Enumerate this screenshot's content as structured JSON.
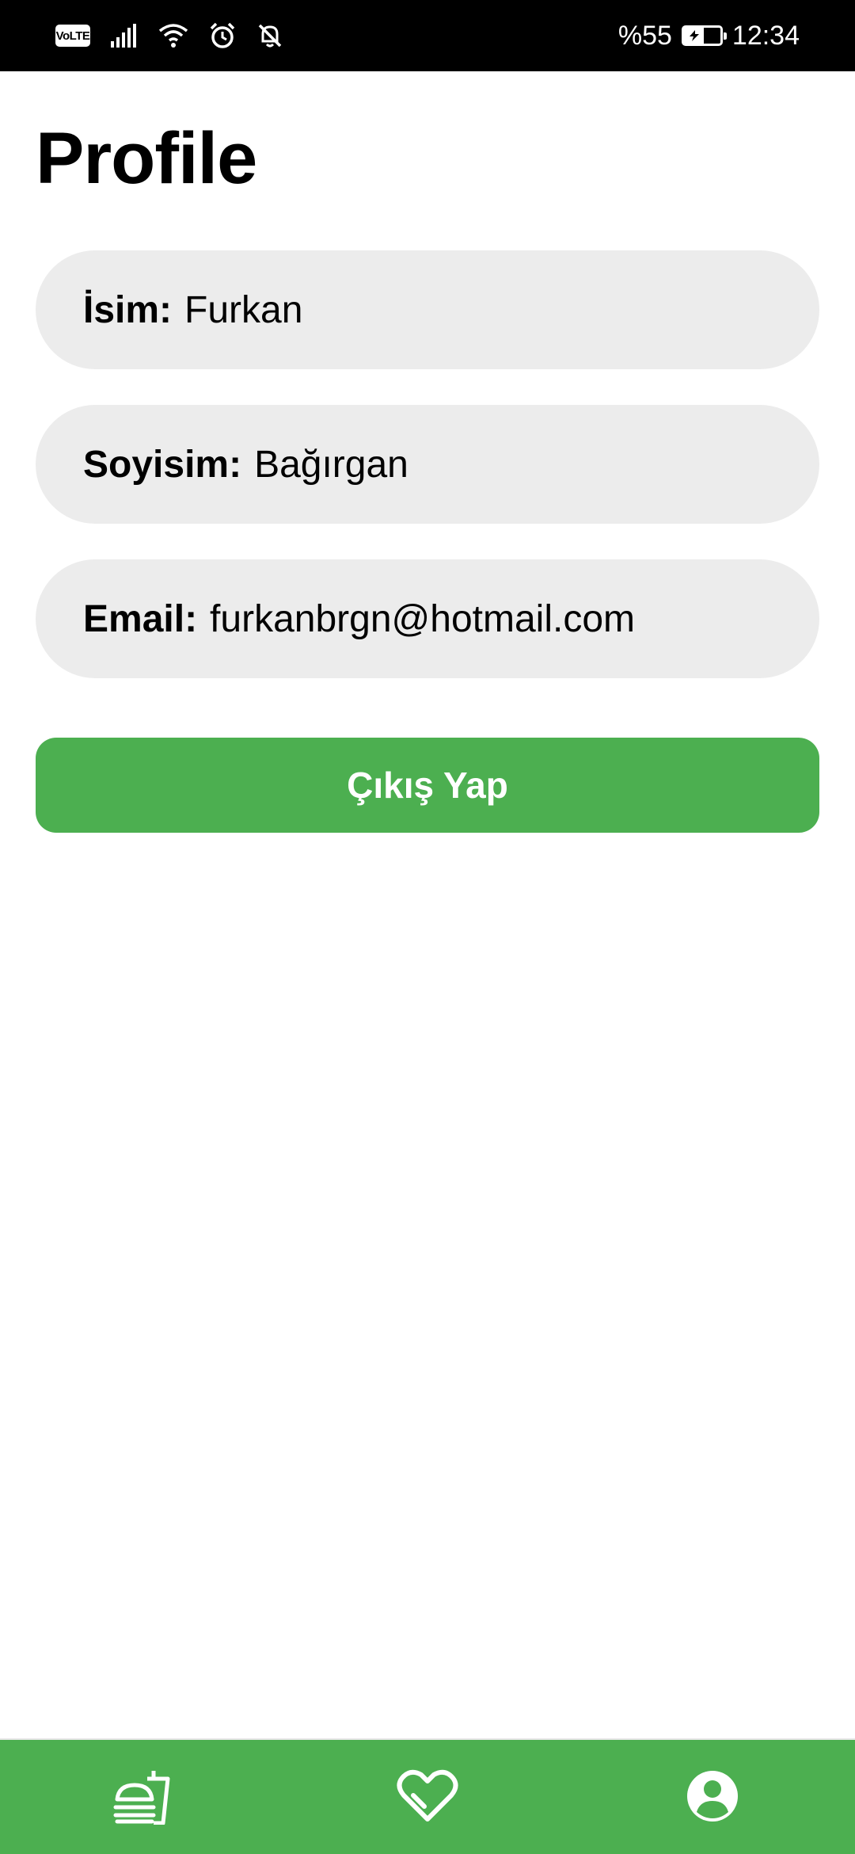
{
  "status_bar": {
    "network_badge": "VoLTE",
    "battery_text": "%55",
    "time": "12:34",
    "battery_level": 0.55,
    "icons": [
      "signal-icon",
      "wifi-icon",
      "alarm-icon",
      "bell-off-icon",
      "battery-charging-icon"
    ]
  },
  "page": {
    "title": "Profile"
  },
  "profile": {
    "name_label": "İsim:",
    "name_value": "Furkan",
    "surname_label": "Soyisim:",
    "surname_value": "Bağırgan",
    "email_label": "Email:",
    "email_value": "furkanbrgn@hotmail.com"
  },
  "actions": {
    "logout_label": "Çıkış Yap"
  },
  "bottom_nav": {
    "items": [
      {
        "icon": "fastfood-icon",
        "active": false
      },
      {
        "icon": "heart-icon",
        "active": false
      },
      {
        "icon": "account-circle-icon",
        "active": true
      }
    ]
  },
  "colors": {
    "accent": "#4caf50",
    "field_background": "#ececec",
    "status_bar": "#000000"
  }
}
